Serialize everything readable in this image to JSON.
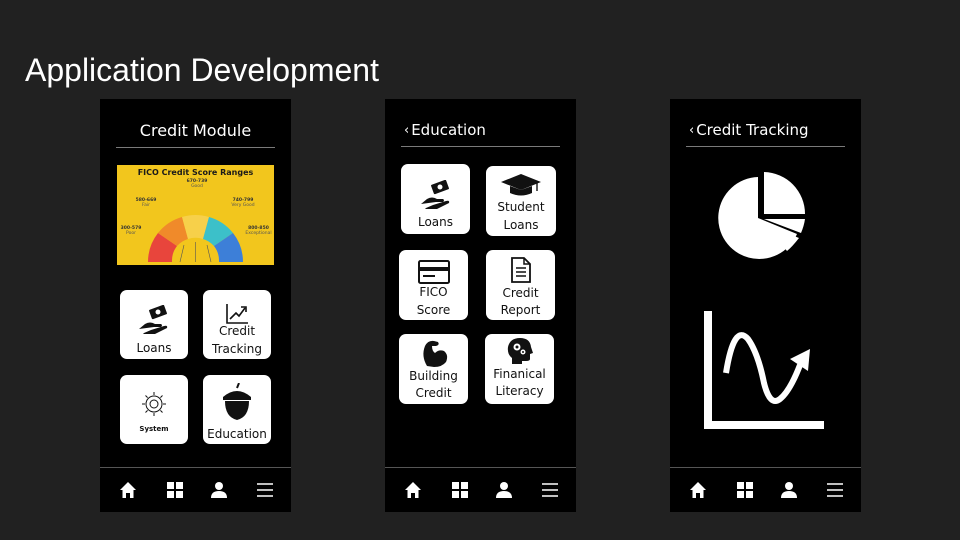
{
  "slide": {
    "title": "Application Development"
  },
  "screens": [
    {
      "header": "Credit Module",
      "fico": {
        "title": "FICO Credit Score Ranges",
        "ranges": [
          {
            "range": "300-579",
            "label": "Poor"
          },
          {
            "range": "580-669",
            "label": "Fair"
          },
          {
            "range": "670-739",
            "label": "Good"
          },
          {
            "range": "740-799",
            "label": "Very Good"
          },
          {
            "range": "800-850",
            "label": "Exceptional"
          }
        ],
        "colors": [
          "#e8453c",
          "#f08a2a",
          "#f7d04a",
          "#3cc0c9",
          "#3d7fd8"
        ]
      },
      "tiles": [
        {
          "label": "Loans",
          "icon": "money-hand-icon"
        },
        {
          "label1": "Credit",
          "label2": "Tracking",
          "icon": "chart-up-icon"
        },
        {
          "label": "System",
          "icon": "gear-icon"
        },
        {
          "label": "Education",
          "icon": "acorn-icon"
        }
      ]
    },
    {
      "header": "Education",
      "back": "‹",
      "tiles": [
        {
          "label": "Loans",
          "icon": "money-hand-icon"
        },
        {
          "label1": "Student",
          "label2": "Loans",
          "icon": "graduation-cap-icon"
        },
        {
          "label1": "FICO",
          "label2": "Score",
          "icon": "credit-card-icon"
        },
        {
          "label1": "Credit",
          "label2": "Report",
          "icon": "document-icon"
        },
        {
          "label1": "Building",
          "label2": "Credit",
          "icon": "muscle-icon"
        },
        {
          "label1": "Finanical",
          "label2": "Literacy",
          "icon": "head-gears-icon"
        }
      ]
    },
    {
      "header": "Credit Tracking",
      "back": "‹",
      "graphics": [
        {
          "icon": "pie-chart-icon"
        },
        {
          "icon": "wave-chart-icon"
        }
      ]
    }
  ],
  "nav": [
    "home-icon",
    "grid-icon",
    "person-icon",
    "menu-icon"
  ],
  "colors": {
    "background": "#212121",
    "phone": "#000000",
    "tile": "#ffffff"
  }
}
